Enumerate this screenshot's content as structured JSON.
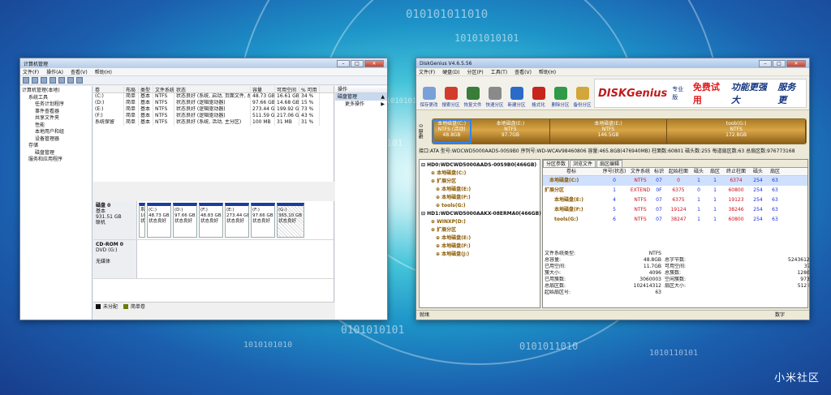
{
  "watermark": "小米社区",
  "decor": {
    "binary_rows": [
      "010101011010",
      "10101010101",
      "0101010110",
      "01010101101",
      "1001010101",
      "0101010101",
      "1010101010",
      "0101011010",
      "1010110101"
    ]
  },
  "cm": {
    "title": "计算机管理",
    "menu": [
      "文件(F)",
      "操作(A)",
      "查看(V)",
      "帮助(H)"
    ],
    "tree": [
      "计算机管理(本地)",
      "系统工具",
      "任务计划程序",
      "事件查看器",
      "共享文件夹",
      "性能",
      "本地用户和组",
      "设备管理器",
      "存储",
      "磁盘管理",
      "服务和应用程序"
    ],
    "vol_headers": [
      "卷",
      "布局",
      "类型",
      "文件系统",
      "状态",
      "容量",
      "可用空间",
      "% 可用"
    ],
    "vol_rows": [
      [
        "(C:)",
        "简单",
        "基本",
        "NTFS",
        "状态良好 (系统, 启动, 页面文件, 故障转储...",
        "48.73 GB",
        "16.61 GB",
        "34 %"
      ],
      [
        "(D:)",
        "简单",
        "基本",
        "NTFS",
        "状态良好 (逻辑驱动器)",
        "97.66 GB",
        "14.68 GB",
        "15 %"
      ],
      [
        "(E:)",
        "简单",
        "基本",
        "NTFS",
        "状态良好 (逻辑驱动器)",
        "273.44 GB",
        "199.92 GB",
        "73 %"
      ],
      [
        "(F:)",
        "简单",
        "基本",
        "NTFS",
        "状态良好 (逻辑驱动器)",
        "511.59 GB",
        "217.06 GB",
        "43 %"
      ],
      [
        "系统保留",
        "简单",
        "基本",
        "NTFS",
        "状态良好 (系统, 活动, 主分区)",
        "100 MB",
        "31 MB",
        "31 %"
      ]
    ],
    "disk0": {
      "label": [
        "磁盘 0",
        "基本",
        "931.51 GB",
        "联机"
      ],
      "parts": [
        [
          "系",
          "10",
          "状"
        ],
        [
          "(C:)",
          "48.73 GB",
          "状态良好"
        ],
        [
          "(D:)",
          "97.66 GB",
          "状态良好"
        ],
        [
          "(F:)",
          "48.83 GB",
          "状态良好"
        ],
        [
          "(E:)",
          "273.44 GB",
          "状态良好"
        ],
        [
          "(F:)",
          "97.66 GB",
          "状态良好"
        ],
        [
          "(G:)",
          "365.10 GB",
          "状态良好"
        ]
      ]
    },
    "cdrom": {
      "label": [
        "CD-ROM 0",
        "DVD (G:)",
        "",
        "无媒体"
      ]
    },
    "legend": [
      "未分配",
      "简单卷"
    ],
    "actions": {
      "header": "操作",
      "section": "磁盘管理",
      "more": "更多操作"
    }
  },
  "dg": {
    "title": "DiskGenius V4.6.5.56",
    "menu": [
      "文件(F)",
      "硬盘(D)",
      "分区(P)",
      "工具(T)",
      "查看(V)",
      "帮助(H)"
    ],
    "toolbar": [
      [
        "保存更改",
        "#7aa0d8"
      ],
      [
        "搜索分区",
        "#d33c2c"
      ],
      [
        "恢复文件",
        "#3a7c3a"
      ],
      [
        "快速分区",
        "#8a8a8a"
      ],
      [
        "新建分区",
        "#2b6ac9"
      ],
      [
        "格式化",
        "#c8251a"
      ],
      [
        "删除分区",
        "#2f9a48"
      ],
      [
        "备份分区",
        "#d2a63a"
      ]
    ],
    "banner": {
      "brand": "DISKGenius",
      "edition": "专业版",
      "hot": "免费试用",
      "slogan": "功能更强大",
      "service": "服务更"
    },
    "disk_label": "硬盘 0",
    "segments": [
      [
        "本地磁盘(C:)",
        "NTFS (活动)",
        "48.8GB",
        true
      ],
      [
        "本地磁盘(E:)",
        "NTFS",
        "97.7GB",
        false
      ],
      [
        "本地磁盘(E:)",
        "NTFS",
        "146.5GB",
        false
      ],
      [
        "toob(G:)",
        "NTFS",
        "172.8GB",
        false
      ]
    ],
    "info": "接口:ATA  型号:WDCWD5000AADS-00S9B0  序列号:WD-WCAV98460806  容量:465.8GB(476940MB)  柱面数:60801  磁头数:255  每道扇区数:63  总扇区数:976773168",
    "tree": [
      [
        "HD0:WDCWD5000AADS-00S9B0(466GB)",
        "b"
      ],
      [
        "本地磁盘(C:)",
        "y"
      ],
      [
        "扩展分区",
        "y"
      ],
      [
        "本地磁盘(E:)",
        "y"
      ],
      [
        "本地磁盘(F:)",
        "y"
      ],
      [
        "tools(G:)",
        "y"
      ],
      [
        "HD1:WDCWD5000AAKX-08ERMA0(466GB)",
        "b"
      ],
      [
        "WINXP(D:)",
        "y"
      ],
      [
        "扩展分区",
        "y"
      ],
      [
        "本地磁盘(E:)",
        "y"
      ],
      [
        "本地磁盘(F:)",
        "y"
      ],
      [
        "本地磁盘(J:)",
        "y"
      ]
    ],
    "tabs": [
      "分区参数",
      "浏览文件",
      "扇区编辑"
    ],
    "part_headers": [
      "卷标",
      "序号(状态)",
      "文件系统",
      "标识",
      "起始柱面",
      "磁头",
      "扇区",
      "终止柱面",
      "磁头",
      "扇区"
    ],
    "part_rows": [
      [
        "本地磁盘(C:)",
        "0",
        "NTFS",
        "07",
        "0",
        "1",
        "1",
        "6374",
        "254",
        "63"
      ],
      [
        "扩展分区",
        "1",
        "EXTEND",
        "0F",
        "6375",
        "0",
        "1",
        "60800",
        "254",
        "63"
      ],
      [
        "本地磁盘(E:)",
        "4",
        "NTFS",
        "07",
        "6375",
        "1",
        "1",
        "19123",
        "254",
        "63"
      ],
      [
        "本地磁盘(F:)",
        "5",
        "NTFS",
        "07",
        "19124",
        "1",
        "1",
        "38246",
        "254",
        "63"
      ],
      [
        "tools(G:)",
        "6",
        "NTFS",
        "07",
        "38247",
        "1",
        "1",
        "60800",
        "254",
        "63"
      ]
    ],
    "details": [
      [
        "文件系统类型:",
        "NTFS",
        "",
        ""
      ],
      [
        "总容量:",
        "48.8GB",
        "总字节数:",
        "52436127744"
      ],
      [
        "已用空间:",
        "11.7GB",
        "可用空间:",
        "37.1GB"
      ],
      [
        "簇大小:",
        "4096",
        "总簇数:",
        "12801788"
      ],
      [
        "已用簇数:",
        "3060003",
        "空闲簇数:",
        "9733785"
      ],
      [
        "总扇区数:",
        "102414312",
        "扇区大小:",
        "512 Bytes"
      ],
      [
        "起始扇区号:",
        "63",
        "",
        ""
      ]
    ],
    "status_left": "就绪",
    "status_right": "数字"
  }
}
